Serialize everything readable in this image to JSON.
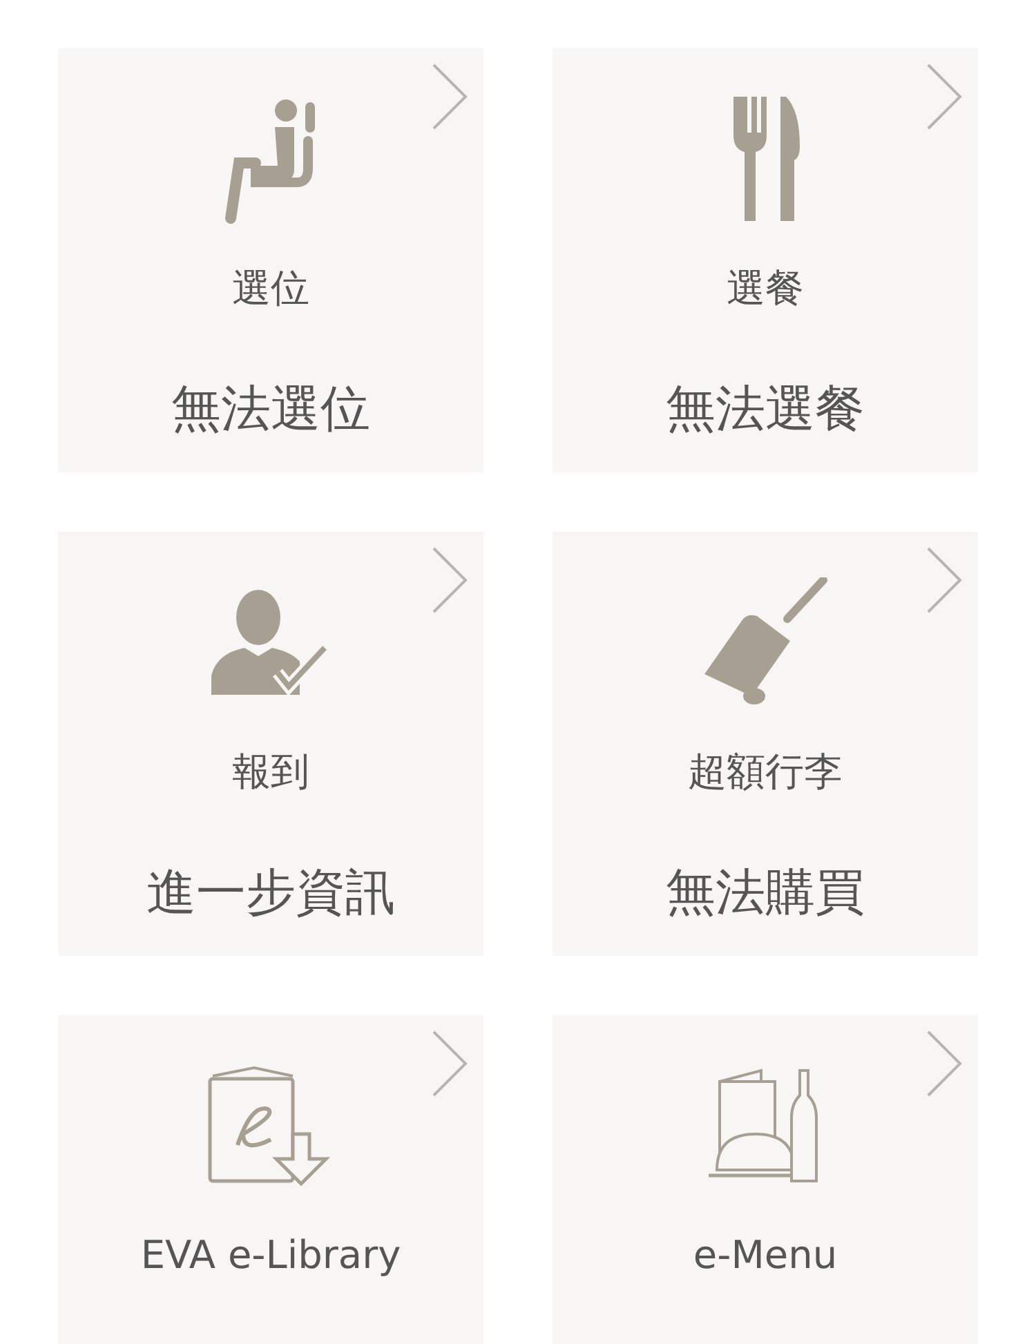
{
  "cards": [
    {
      "kind": "seat",
      "title": "選位",
      "status": "無法選位"
    },
    {
      "kind": "meal",
      "title": "選餐",
      "status": "無法選餐"
    },
    {
      "kind": "checkin",
      "title": "報到",
      "status": "進一步資訊"
    },
    {
      "kind": "baggage",
      "title": "超額行李",
      "status": "無法購買"
    },
    {
      "kind": "library",
      "title": "EVA e-Library"
    },
    {
      "kind": "menu",
      "title": "e-Menu"
    }
  ]
}
